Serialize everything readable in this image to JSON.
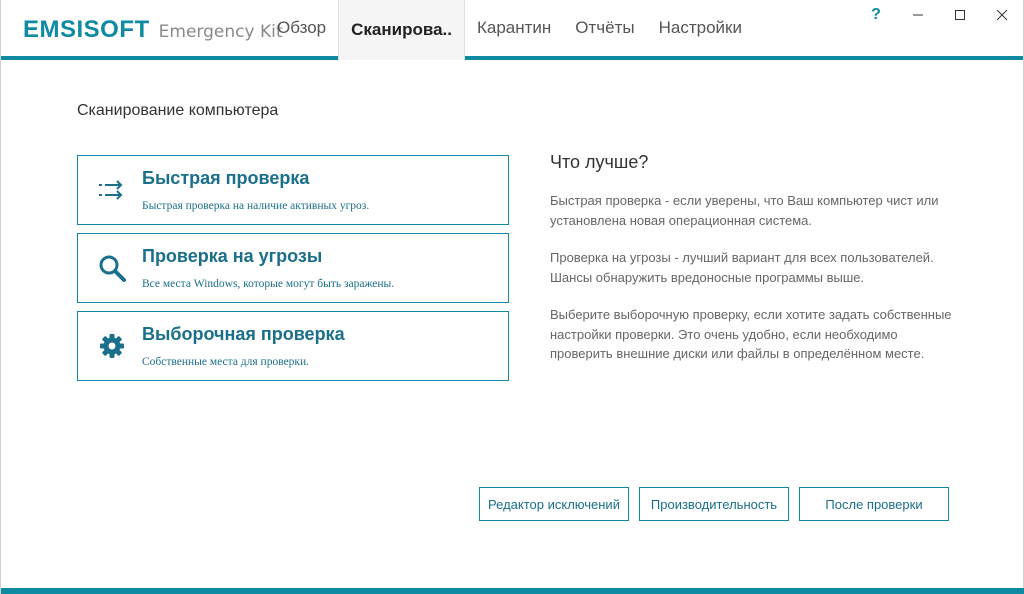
{
  "app": {
    "logo_main": "EMSISOFT",
    "logo_sub": "Emergency Kit"
  },
  "tabs": [
    {
      "label": "Обзор",
      "active": false
    },
    {
      "label": "Сканирова..",
      "active": true
    },
    {
      "label": "Карантин",
      "active": false
    },
    {
      "label": "Отчёты",
      "active": false
    },
    {
      "label": "Настройки",
      "active": false
    }
  ],
  "window_controls": {
    "help": "?"
  },
  "main": {
    "section_title": "Сканирование компьютера",
    "options": [
      {
        "title": "Быстрая проверка",
        "desc": "Быстрая проверка на наличие активных угроз.",
        "icon": "quick-scan-arrows-icon"
      },
      {
        "title": "Проверка на угрозы",
        "desc": "Все места Windows, которые могут быть заражены.",
        "icon": "magnifier-icon"
      },
      {
        "title": "Выборочная проверка",
        "desc": "Собственные места для проверки.",
        "icon": "gear-icon"
      }
    ],
    "info": {
      "title": "Что лучше?",
      "paragraphs": [
        "Быстрая проверка - если уверены, что Ваш компьютер чист или установлена новая операционная система.",
        "Проверка на угрозы - лучший вариант для всех пользователей. Шансы обнаружить вредоносные программы выше.",
        "Выберите выборочную проверку, если хотите задать собственные настройки проверки. Это очень удобно, если необходимо проверить внешние диски или файлы в определённом месте."
      ]
    },
    "buttons": {
      "exclusions": "Редактор исключений",
      "performance": "Производительность",
      "after_scan": "После проверки"
    }
  },
  "colors": {
    "accent": "#0f8aa3",
    "title_text": "#1a6f8a"
  }
}
